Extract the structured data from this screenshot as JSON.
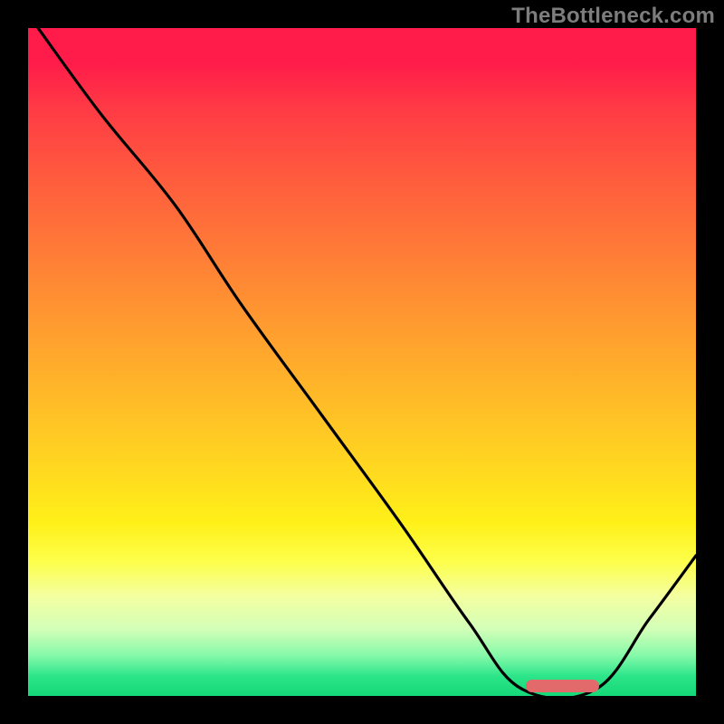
{
  "watermark": "TheBottleneck.com",
  "colors": {
    "frame": "#000000",
    "watermark": "#7d7d7d",
    "curve": "#000000",
    "marker": "#e26a6a",
    "gradient_stops": [
      {
        "offset": 0.0,
        "color": "#ff1b4a"
      },
      {
        "offset": 0.05,
        "color": "#ff1b4a"
      },
      {
        "offset": 0.12,
        "color": "#ff3a45"
      },
      {
        "offset": 0.22,
        "color": "#ff5a3e"
      },
      {
        "offset": 0.33,
        "color": "#ff7a37"
      },
      {
        "offset": 0.44,
        "color": "#ff9a30"
      },
      {
        "offset": 0.55,
        "color": "#ffb928"
      },
      {
        "offset": 0.66,
        "color": "#ffd820"
      },
      {
        "offset": 0.74,
        "color": "#fff018"
      },
      {
        "offset": 0.8,
        "color": "#fdff4c"
      },
      {
        "offset": 0.85,
        "color": "#f4ffa0"
      },
      {
        "offset": 0.9,
        "color": "#d3ffb8"
      },
      {
        "offset": 0.94,
        "color": "#84f9a9"
      },
      {
        "offset": 0.97,
        "color": "#2de58a"
      },
      {
        "offset": 1.0,
        "color": "#14d877"
      }
    ]
  },
  "chart_data": {
    "type": "line",
    "title": "",
    "xlabel": "",
    "ylabel": "",
    "xlim": [
      0,
      1
    ],
    "ylim": [
      0,
      1
    ],
    "note": "x and y are normalized to the plot area (0–1). y=1 is top, y=0 is bottom. The curve descends from top-left, has a gentle bend near x≈0.22, continues down to a flat valley at y≈0 between x≈0.74 and x≈0.85, then rises toward the right edge.",
    "series": [
      {
        "name": "curve",
        "points": [
          {
            "x": 0.015,
            "y": 1.0
          },
          {
            "x": 0.11,
            "y": 0.87
          },
          {
            "x": 0.22,
            "y": 0.735
          },
          {
            "x": 0.32,
            "y": 0.585
          },
          {
            "x": 0.44,
            "y": 0.42
          },
          {
            "x": 0.56,
            "y": 0.255
          },
          {
            "x": 0.66,
            "y": 0.11
          },
          {
            "x": 0.74,
            "y": 0.01
          },
          {
            "x": 0.85,
            "y": 0.01
          },
          {
            "x": 0.93,
            "y": 0.115
          },
          {
            "x": 1.0,
            "y": 0.21
          }
        ]
      }
    ],
    "marker": {
      "shape": "rounded-bar",
      "x_start": 0.745,
      "x_end": 0.855,
      "y": 0.015,
      "color": "#e26a6a"
    }
  }
}
